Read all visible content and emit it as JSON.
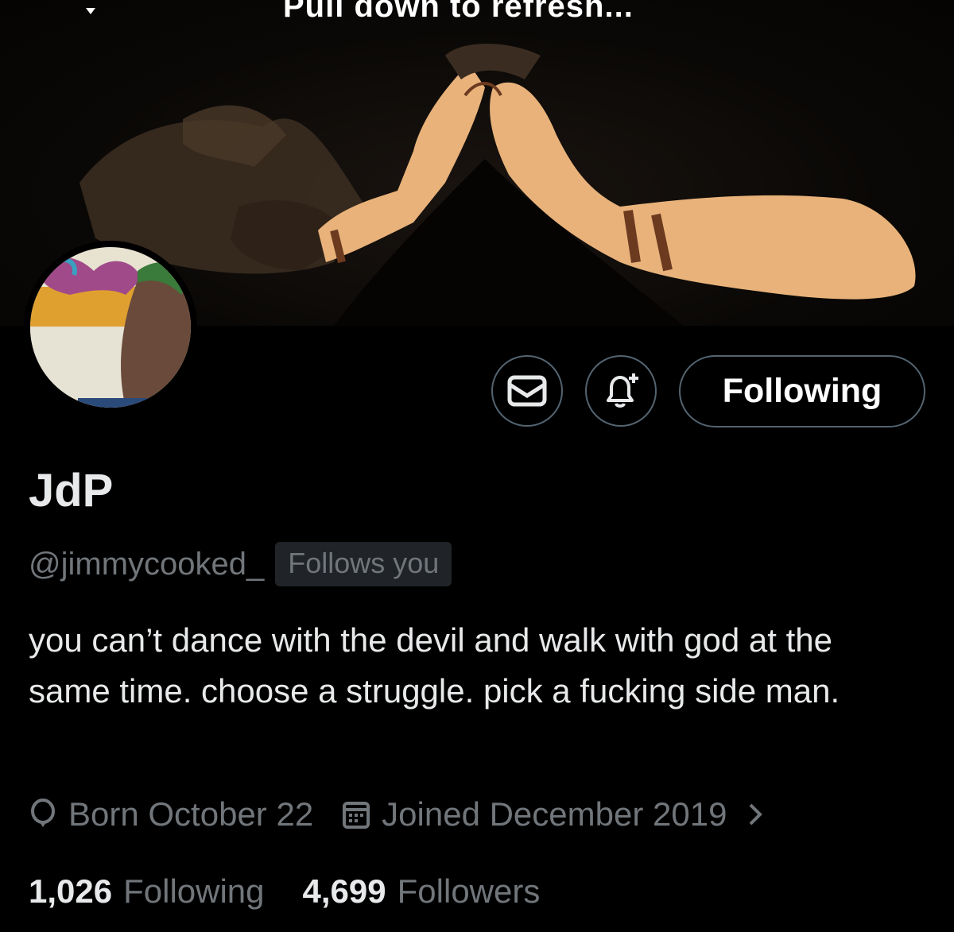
{
  "header": {
    "refresh_text": "Pull down to refresh..."
  },
  "profile": {
    "display_name": "JdP",
    "handle": "@jimmycooked_",
    "follows_you_badge": "Follows you",
    "bio": "you can’t dance with the devil and walk with god at the same time. choose a struggle. pick a fucking side man.",
    "birthday": "Born October 22",
    "joined": "Joined December 2019",
    "following_count": "1,026",
    "following_label": "Following",
    "followers_count": "4,699",
    "followers_label": "Followers"
  },
  "actions": {
    "message_icon": "envelope-icon",
    "notify_icon": "bell-plus-icon",
    "following_button": "Following"
  },
  "colors": {
    "background": "#000000",
    "primary_text": "#e7e9ea",
    "secondary_text": "#71767b",
    "border": "#536471",
    "badge_bg": "#202327",
    "banner_arms": "#e8b27a"
  }
}
